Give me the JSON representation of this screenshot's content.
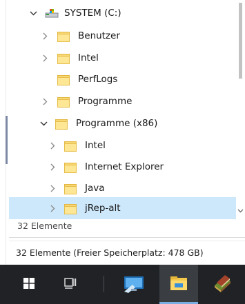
{
  "tree": {
    "items": [
      {
        "label": "SYSTEM (C:)",
        "expanded": true,
        "icon": "drive-icon"
      },
      {
        "label": "Benutzer",
        "expanded": false,
        "icon": "folder-icon"
      },
      {
        "label": "Intel",
        "expanded": false,
        "icon": "folder-icon"
      },
      {
        "label": "PerfLogs",
        "expanded": false,
        "icon": "folder-icon"
      },
      {
        "label": "Programme",
        "expanded": false,
        "icon": "folder-icon"
      },
      {
        "label": "Programme (x86)",
        "expanded": true,
        "icon": "folder-icon"
      },
      {
        "label": "Intel",
        "expanded": false,
        "icon": "folder-icon"
      },
      {
        "label": "Internet Explorer",
        "expanded": false,
        "icon": "folder-icon"
      },
      {
        "label": "Java",
        "expanded": false,
        "icon": "folder-icon"
      },
      {
        "label": "jRep-alt",
        "expanded": false,
        "selected": true,
        "icon": "folder-icon"
      }
    ],
    "item_count": "32 Elemente"
  },
  "status_bar": {
    "text": "32 Elemente (Freier Speicherplatz: 478 GB)"
  },
  "taskbar": {
    "items": [
      {
        "name": "start-button",
        "icon": "windows-logo-icon"
      },
      {
        "name": "task-view-button",
        "icon": "task-view-icon"
      },
      {
        "name": "remote-desktop-app",
        "icon": "remote-desktop-icon"
      },
      {
        "name": "file-explorer-app",
        "icon": "file-explorer-icon",
        "active": true
      },
      {
        "name": "books-app",
        "icon": "books-icon"
      }
    ]
  },
  "colors": {
    "selection": "#cde8fb",
    "taskbar": "#202226",
    "folder": "#f8d775",
    "active_indicator": "#7aaee2"
  }
}
